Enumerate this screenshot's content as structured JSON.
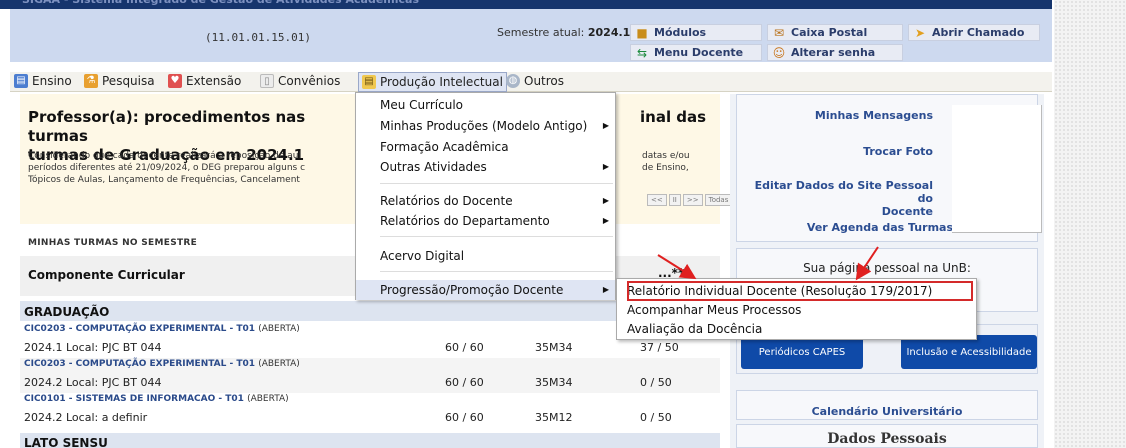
{
  "header": {
    "unit_code": "(11.01.01.15.01)",
    "semester_label": "Semestre atual:",
    "semester_value": "2024.1"
  },
  "header_buttons": [
    {
      "label": "Módulos",
      "icon": "modules-icon"
    },
    {
      "label": "Caixa Postal",
      "icon": "mailbox-icon"
    },
    {
      "label": "Abrir Chamado",
      "icon": "ticket-icon"
    },
    {
      "label": "Menu Docente",
      "icon": "teacher-menu-icon"
    },
    {
      "label": "Alterar senha",
      "icon": "password-icon"
    }
  ],
  "menubar": {
    "items": [
      "Ensino",
      "Pesquisa",
      "Extensão",
      "Convênios",
      "Produção Intelectual",
      "Outros"
    ],
    "active": "Produção Intelectual"
  },
  "notice": {
    "title": "Professor(a): procedimentos nas turmas",
    "title_line2": "turmas de Graduação em 2024.1",
    "title_tail": "inal das",
    "lines": [
      "Considerando que cada docente realizará a reposição de aul",
      "períodos diferentes até 21/09/2024, o DEG preparou alguns c",
      "Tópicos de Aulas, Lançamento de Frequências, Cancelament"
    ],
    "lines_tail": [
      "datas e/ou",
      "de Ensino,"
    ],
    "pager": [
      "<<",
      "II",
      ">>",
      "Todas"
    ]
  },
  "turmas": {
    "section_title": "MINHAS TURMAS NO SEMESTRE",
    "col_componente": "Componente Curricular",
    "col_alunos_fragment": "...**",
    "group_grad": "GRADUAÇÃO",
    "group_lato": "LATO SENSU",
    "rows": [
      {
        "course": "CIC0203 - COMPUTAÇÃO EXPERIMENTAL - T01",
        "status": "(ABERTA)",
        "loc": "2024.1 Local: PJC BT 044",
        "ch": "60 / 60",
        "horario": "35M34",
        "vagas": "37 / 50"
      },
      {
        "course": "CIC0203 - COMPUTAÇÃO EXPERIMENTAL - T01",
        "status": "(ABERTA)",
        "loc": "2024.2 Local: PJC BT 044",
        "ch": "60 / 60",
        "horario": "35M34",
        "vagas": "0 / 50"
      },
      {
        "course": "CIC0101 - SISTEMAS DE INFORMACAO - T01",
        "status": "(ABERTA)",
        "loc": "2024.2 Local: a definir",
        "ch": "60 / 60",
        "horario": "35M12",
        "vagas": "0 / 50"
      }
    ]
  },
  "dropdown": {
    "items": [
      "Meu Currículo",
      "Minhas Produções (Modelo Antigo)",
      "Formação Acadêmica",
      "Outras Atividades",
      "Relatórios do Docente",
      "Relatórios do Departamento",
      "Acervo Digital",
      "Progressão/Promoção Docente"
    ],
    "highlighted": "Progressão/Promoção Docente"
  },
  "submenu": {
    "items": [
      "Relatório Individual Docente (Resolução 179/2017)",
      "Acompanhar Meus Processos",
      "Avaliação da Docência"
    ],
    "boxed": "Relatório Individual Docente (Resolução 179/2017)"
  },
  "side": {
    "links": {
      "mensagens": "Minhas Mensagens",
      "foto": "Trocar Foto",
      "site_l1": "Editar Dados do Site Pessoal do",
      "site_l2": "Docente",
      "agenda": "Ver Agenda das Turmas"
    },
    "pessoal": "Sua página pessoal na UnB:",
    "btn_capes": "Periódicos CAPES",
    "btn_incl": "Inclusão e Acessibilidade",
    "calendario": "Calendário Universitário",
    "dados": "Dados Pessoais"
  },
  "colors": {
    "highlight_red": "#d42a2a",
    "link_blue": "#2b4d91",
    "header_blue": "#cdd9ef",
    "button_blue": "#0f4aa8"
  }
}
